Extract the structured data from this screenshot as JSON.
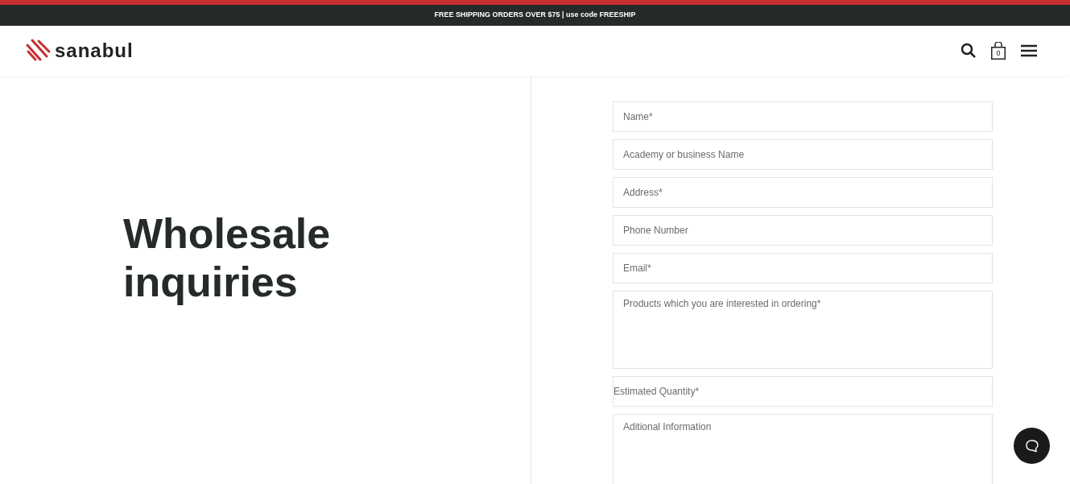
{
  "announcement": "FREE SHIPPING ORDERS OVER $75 | use code FREESHIP",
  "header": {
    "logo_text": "sanabul",
    "cart_count": "0"
  },
  "heading": "Wholesale inquiries",
  "form": {
    "fields": [
      {
        "kind": "input",
        "placeholder": "Name*"
      },
      {
        "kind": "input",
        "placeholder": "Academy or business Name"
      },
      {
        "kind": "input",
        "placeholder": "Address*"
      },
      {
        "kind": "input",
        "placeholder": "Phone Number"
      },
      {
        "kind": "input",
        "placeholder": "Email*"
      },
      {
        "kind": "textarea",
        "placeholder": "Products which you are interested in ordering*"
      },
      {
        "kind": "bare",
        "placeholder": "Estimated Quantity*"
      },
      {
        "kind": "textarea",
        "placeholder": "Aditional Information"
      }
    ]
  }
}
